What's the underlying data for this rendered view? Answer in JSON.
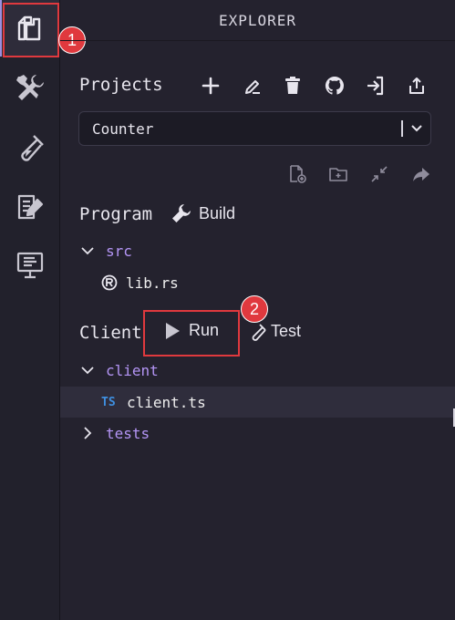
{
  "activity_bar": {
    "items": [
      {
        "name": "explorer",
        "icon": "files-icon",
        "active": true
      },
      {
        "name": "build-deploy",
        "icon": "tools-icon",
        "active": false
      },
      {
        "name": "test",
        "icon": "test-tube-icon",
        "active": false
      },
      {
        "name": "tutorials",
        "icon": "document-pencil-icon",
        "active": false
      },
      {
        "name": "monitor",
        "icon": "monitor-icon",
        "active": false
      }
    ]
  },
  "annotations": {
    "badge1": "1",
    "badge2": "2",
    "color": "#e0393e"
  },
  "panel": {
    "title": "EXPLORER",
    "projects": {
      "label": "Projects",
      "actions": [
        "plus-icon",
        "rename-pencil-icon",
        "trash-icon",
        "github-icon",
        "import-icon",
        "export-icon"
      ],
      "selected_project": "Counter",
      "file_actions": [
        "new-file-icon",
        "new-folder-icon",
        "collapse-icon",
        "share-icon"
      ]
    },
    "program": {
      "label": "Program",
      "build_label": "Build",
      "folder": "src",
      "file": "lib.rs"
    },
    "client": {
      "label": "Client",
      "run_label": "Run",
      "test_label": "Test",
      "folder": "client",
      "file": "client.ts",
      "file_badge": "TS",
      "tests_folder": "tests"
    }
  },
  "colors": {
    "background": "#24222e",
    "folder": "#b495f5",
    "ts": "#3f8fe0",
    "selected_row": "#2f2d3c"
  }
}
